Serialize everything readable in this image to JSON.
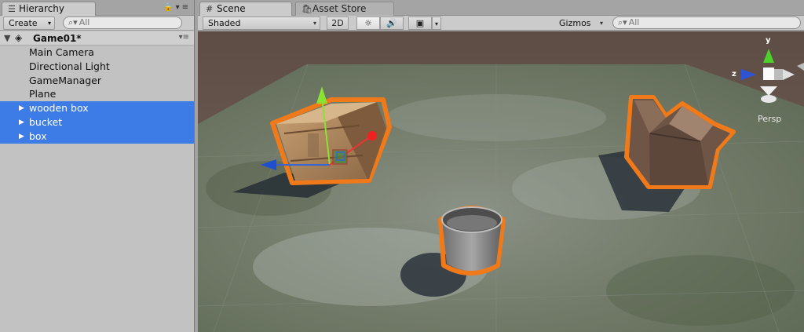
{
  "hierarchy": {
    "tab_label": "Hierarchy",
    "create_label": "Create",
    "search_placeholder": "All",
    "scene_name": "Game01*",
    "items": [
      {
        "label": "Main Camera",
        "selected": false
      },
      {
        "label": "Directional Light",
        "selected": false
      },
      {
        "label": "GameManager",
        "selected": false
      },
      {
        "label": "Plane",
        "selected": false
      },
      {
        "label": "wooden box",
        "selected": true
      },
      {
        "label": "bucket",
        "selected": true
      },
      {
        "label": "box",
        "selected": true
      }
    ]
  },
  "scene": {
    "tab_label": "Scene",
    "asset_store_label": "Asset Store",
    "shading_mode": "Shaded",
    "mode_2d_label": "2D",
    "gizmos_label": "Gizmos",
    "search_placeholder": "All",
    "projection_label": "Persp",
    "axis_labels": {
      "y": "y",
      "z": "z"
    }
  },
  "colors": {
    "selection_blue": "#3d7ce6",
    "outline_orange": "#f07a1a",
    "ground_dark": "#6c5a50"
  },
  "icons": [
    "list-icon",
    "hash-icon",
    "bag-icon",
    "lock-icon",
    "menu-icon",
    "unity-logo-icon",
    "search-icon",
    "sun-icon",
    "speaker-icon",
    "image-icon"
  ]
}
